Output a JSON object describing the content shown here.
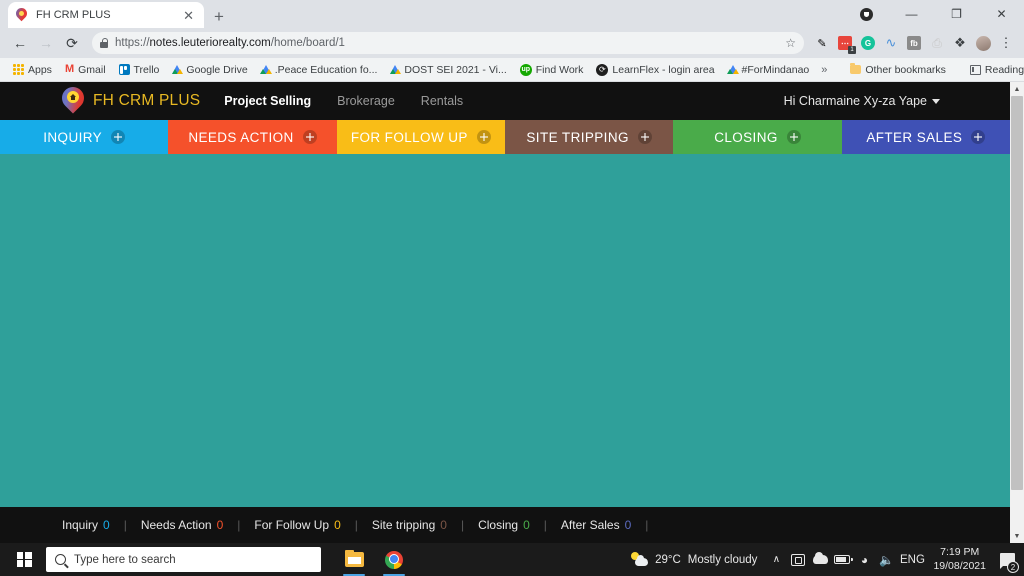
{
  "browser": {
    "tab": {
      "title": "FH CRM PLUS",
      "favicon": "map-pin-icon",
      "close": "✕"
    },
    "new_tab_label": "+",
    "window_controls": {
      "minimize": "—",
      "maximize": "❐",
      "close": "✕"
    },
    "nav": {
      "back": "←",
      "forward": "→",
      "reload": "⟳"
    },
    "omnibox": {
      "scheme": "https://",
      "host": "notes.leuteriorealty.com",
      "path": "/home/board/1",
      "full_url": "https://notes.leuteriorealty.com/home/board/1",
      "lock_icon": "padlock-icon",
      "star_icon": "☆"
    },
    "extensions": [
      {
        "name": "eyedropper-icon",
        "glyph": "✐"
      },
      {
        "name": "password-manager-icon",
        "glyph": "⋯",
        "badge": "1",
        "color": "#e8453c"
      },
      {
        "name": "grammarly-icon",
        "glyph": "G",
        "color": "#15c39a"
      },
      {
        "name": "wave-icon",
        "glyph": "≈",
        "color": "#4a90d9"
      },
      {
        "name": "facebook-tool-icon",
        "glyph": "fb",
        "color": "#8a8a8a"
      },
      {
        "name": "printer-icon",
        "glyph": "⎙",
        "color": "#c0c0c0"
      },
      {
        "name": "extensions-puzzle-icon",
        "glyph": "❖"
      },
      {
        "name": "profile-avatar",
        "glyph": ""
      },
      {
        "name": "chrome-menu-icon",
        "glyph": "⋮"
      }
    ],
    "bookmarks": [
      {
        "label": "Apps",
        "icon": "apps-grid-icon"
      },
      {
        "label": "Gmail",
        "icon": "gmail-icon"
      },
      {
        "label": "Trello",
        "icon": "trello-icon"
      },
      {
        "label": "Google Drive",
        "icon": "google-drive-icon"
      },
      {
        "label": ".Peace Education fo...",
        "icon": "google-drive-icon"
      },
      {
        "label": "DOST SEI 2021 - Vi...",
        "icon": "google-drive-icon"
      },
      {
        "label": "Find Work",
        "icon": "upwork-icon"
      },
      {
        "label": "LearnFlex - login area",
        "icon": "learnflex-icon"
      },
      {
        "label": "#ForMindanao",
        "icon": "google-drive-icon"
      }
    ],
    "bookmarks_overflow": "»",
    "other_bookmarks": {
      "label": "Other bookmarks",
      "icon": "folder-icon"
    },
    "reading_list": {
      "label": "Reading list",
      "icon": "reading-list-icon"
    }
  },
  "app": {
    "brand": {
      "name": "FH CRM PLUS",
      "logo": "map-pin-house-icon",
      "color": "#e8b923"
    },
    "nav": [
      {
        "label": "Project Selling",
        "active": true
      },
      {
        "label": "Brokerage",
        "active": false
      },
      {
        "label": "Rentals",
        "active": false
      }
    ],
    "user_menu": {
      "label": "Hi Charmaine Xy-za Yape",
      "caret": "▾"
    },
    "board": {
      "background_color": "#2fa09a",
      "columns": [
        {
          "label": "INQUIRY",
          "color": "#17ace8",
          "add_icon": "plus-circle-icon"
        },
        {
          "label": "NEEDS ACTION",
          "color": "#f5512b",
          "add_icon": "plus-circle-icon"
        },
        {
          "label": "FOR FOLLOW UP",
          "color": "#f9bd17",
          "add_icon": "plus-circle-icon"
        },
        {
          "label": "SITE TRIPPING",
          "color": "#7b5546",
          "add_icon": "plus-circle-icon"
        },
        {
          "label": "CLOSING",
          "color": "#4aab4a",
          "add_icon": "plus-circle-icon"
        },
        {
          "label": "AFTER SALES",
          "color": "#3f51b5",
          "add_icon": "plus-circle-icon"
        }
      ],
      "cards": []
    },
    "status_bar": {
      "separator": "|",
      "items": [
        {
          "label": "Inquiry",
          "count": "0",
          "color": "#17ace8"
        },
        {
          "label": "Needs Action",
          "count": "0",
          "color": "#f5512b"
        },
        {
          "label": "For Follow Up",
          "count": "0",
          "color": "#f9bd17"
        },
        {
          "label": "Site tripping",
          "count": "0",
          "color": "#7b5546"
        },
        {
          "label": "Closing",
          "count": "0",
          "color": "#4aab4a"
        },
        {
          "label": "After Sales",
          "count": "0",
          "color": "#5c6bc0"
        }
      ]
    }
  },
  "taskbar": {
    "start_icon": "windows-logo-icon",
    "search": {
      "placeholder": "Type here to search",
      "icon": "search-icon"
    },
    "pinned": [
      {
        "name": "file-explorer-icon"
      },
      {
        "name": "google-chrome-icon"
      }
    ],
    "tray": {
      "weather": {
        "temperature": "29°C",
        "condition": "Mostly cloudy",
        "icon": "partly-sunny-icon"
      },
      "overflow": "∧",
      "icons": [
        "screen-share-icon",
        "onedrive-icon",
        "battery-icon",
        "wifi-icon",
        "volume-icon"
      ],
      "language": "ENG",
      "time": "7:19 PM",
      "date": "19/08/2021",
      "notifications": {
        "icon": "notification-icon",
        "count": "2"
      }
    }
  }
}
